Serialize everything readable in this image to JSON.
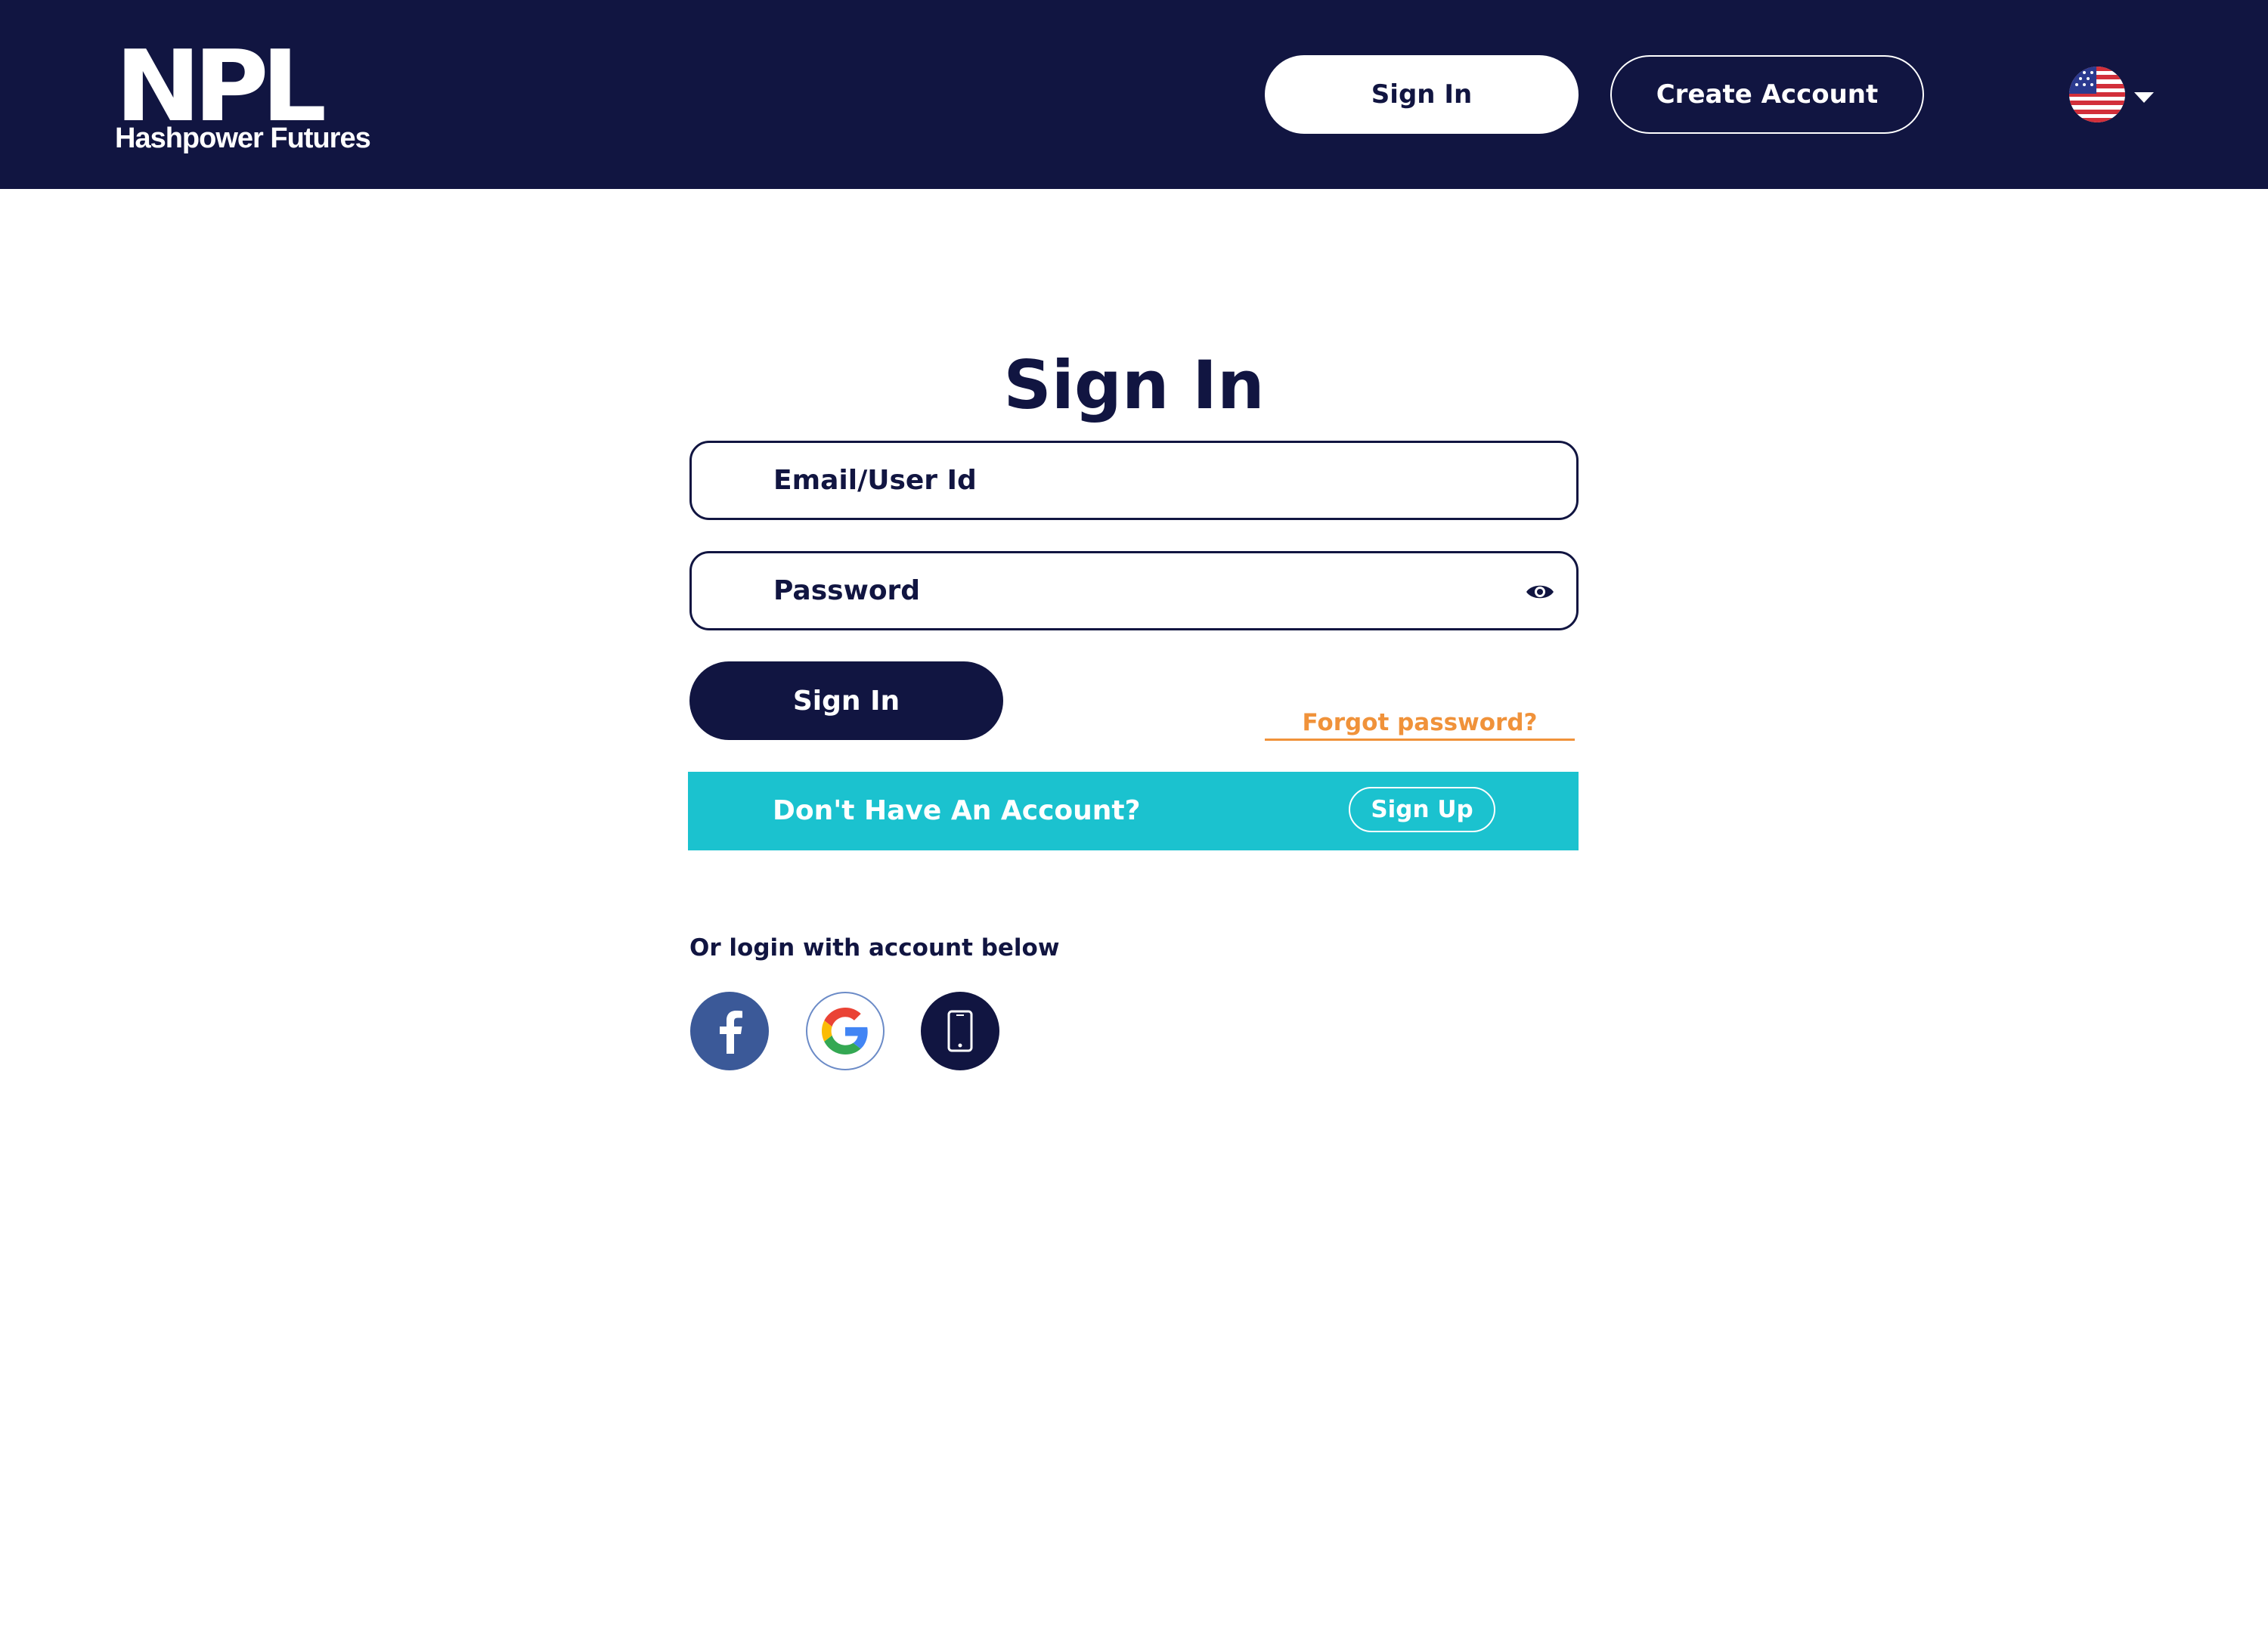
{
  "header": {
    "logo_mark": "NPL",
    "logo_sub": "Hashpower Futures",
    "signin_label": "Sign In",
    "create_account_label": "Create Account",
    "language_icon": "us-flag-icon"
  },
  "form": {
    "title": "Sign In",
    "email_placeholder": "Email/User Id",
    "password_placeholder": "Password",
    "signin_button": "Sign In",
    "forgot_password": "Forgot password?",
    "no_account_text": "Don't Have An Account?",
    "signup_button": "Sign Up",
    "alt_login_text": "Or login with account below"
  },
  "social": [
    {
      "icon": "facebook-icon"
    },
    {
      "icon": "google-icon"
    },
    {
      "icon": "phone-icon"
    }
  ],
  "colors": {
    "navy": "#111541",
    "accent_orange": "#f0923a",
    "cyan_bar": "#1bc2cf",
    "facebook": "#3b5998"
  }
}
